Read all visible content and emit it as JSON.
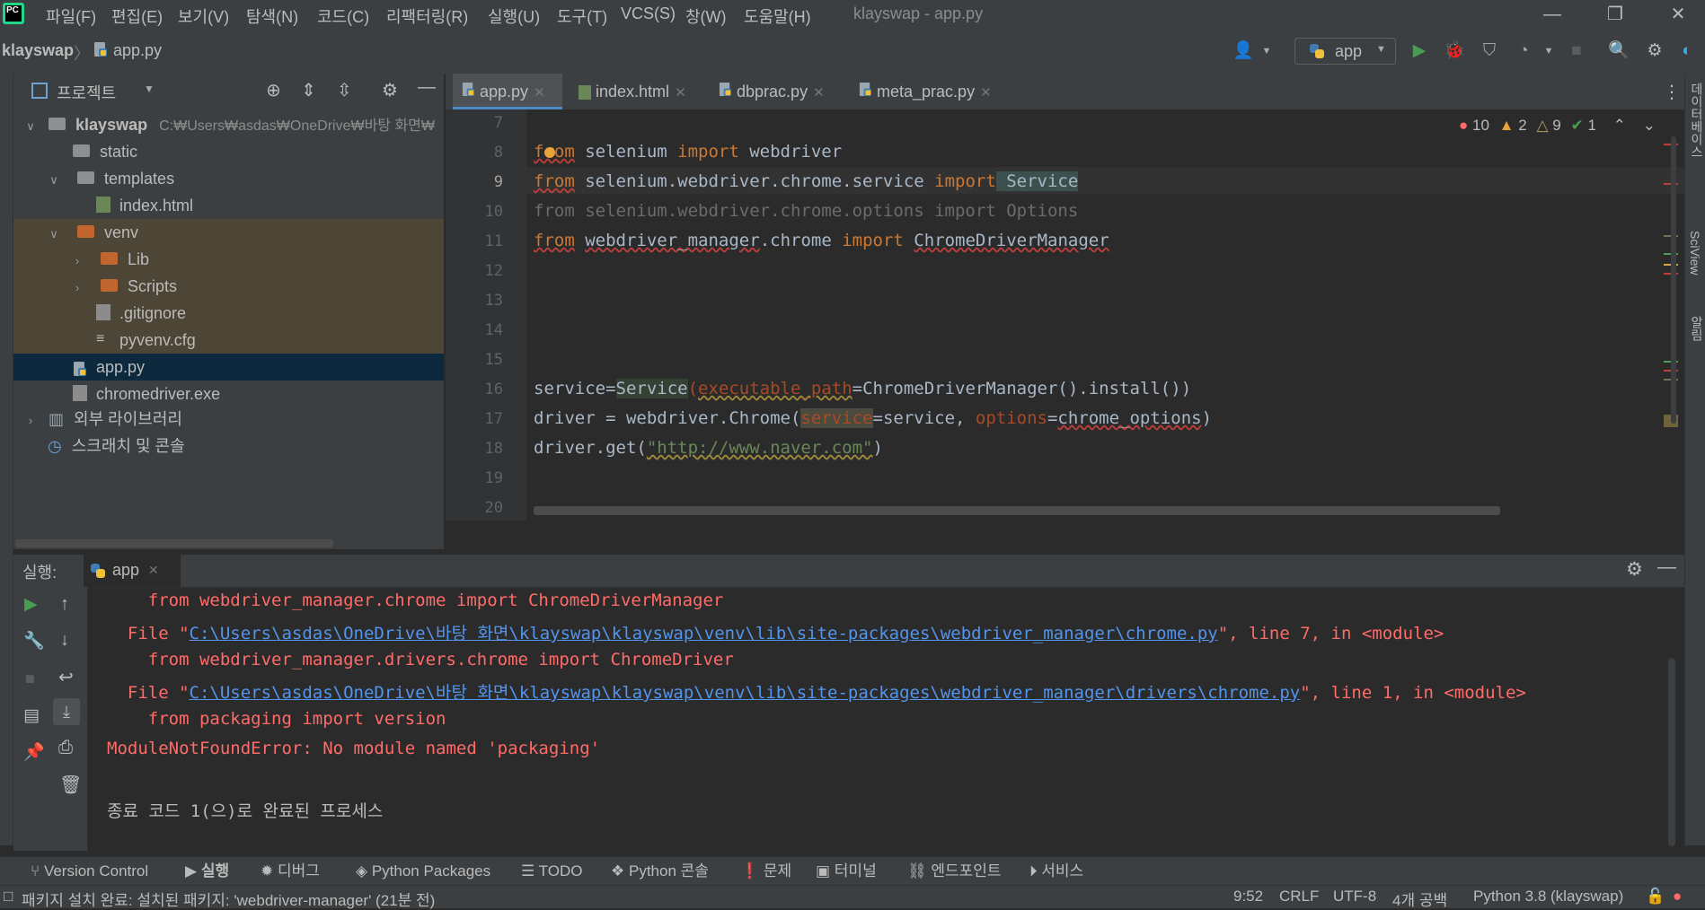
{
  "titlebar": {
    "menus": [
      "파일(F)",
      "편집(E)",
      "보기(V)",
      "탐색(N)",
      "코드(C)",
      "리팩터링(R)",
      "실행(U)",
      "도구(T)",
      "VCS(S)",
      "창(W)",
      "도움말(H)"
    ],
    "title": "klayswap - app.py",
    "logo_text": "PC"
  },
  "navbar": {
    "project": "klayswap",
    "file": "app.py",
    "run_config": "app"
  },
  "project_panel": {
    "header": "프로젝트",
    "root_name": "klayswap",
    "root_path": "C:₩Users₩asdas₩OneDrive₩바탕 화면₩",
    "items": [
      "static",
      "templates",
      "index.html",
      "venv",
      "Lib",
      "Scripts",
      ".gitignore",
      "pyvenv.cfg",
      "app.py",
      "chromedriver.exe",
      "외부 라이브러리",
      "스크래치 및 콘솔"
    ]
  },
  "editor": {
    "tabs": [
      "app.py",
      "index.html",
      "dbprac.py",
      "meta_prac.py"
    ],
    "inspections": {
      "errors": "10",
      "warnings": "2",
      "weak_warnings": "9",
      "ok": "1"
    },
    "line_numbers": [
      "7",
      "8",
      "9",
      "10",
      "11",
      "12",
      "13",
      "14",
      "15",
      "16",
      "17",
      "18",
      "19",
      "20"
    ],
    "code": {
      "l8": [
        "from",
        " selenium ",
        "import",
        " webdriver"
      ],
      "l9": [
        "from",
        " selenium.webdriver.chrome.service ",
        "import",
        " Service"
      ],
      "l10": "from selenium.webdriver.chrome.options import Options",
      "l11": [
        "from",
        " ",
        "webdriver_manager",
        ".chrome ",
        "import",
        " ",
        "ChromeDriverManager"
      ],
      "l16": [
        "service=",
        "Service",
        "(",
        "executable_path",
        "=ChromeDriverManager().install())"
      ],
      "l17": [
        "driver = webdriver.Chrome(",
        "service",
        "=service, ",
        "options",
        "=",
        "chrome_options",
        ")"
      ],
      "l18": [
        "driver.get(",
        "\"http://www.naver.com\"",
        ")"
      ]
    }
  },
  "run_panel": {
    "label": "실행:",
    "tab": "app",
    "output": [
      "    from webdriver_manager.chrome import ChromeDriverManager",
      "  File \"",
      "C:\\Users\\asdas\\OneDrive\\바탕 화면\\klayswap\\klayswap\\venv\\lib\\site-packages\\webdriver_manager\\chrome.py",
      "\", line 7, in <module>",
      "    from webdriver_manager.drivers.chrome import ChromeDriver",
      "  File \"",
      "C:\\Users\\asdas\\OneDrive\\바탕 화면\\klayswap\\klayswap\\venv\\lib\\site-packages\\webdriver_manager\\drivers\\chrome.py",
      "\", line 1, in <module>",
      "    from packaging import version",
      "ModuleNotFoundError: No module named 'packaging'",
      "종료 코드 1(으)로 완료된 프로세스"
    ]
  },
  "tool_tabs": [
    "Version Control",
    "실행",
    "디버그",
    "Python Packages",
    "TODO",
    "Python 콘솔",
    "문제",
    "터미널",
    "엔드포인트",
    "서비스"
  ],
  "statusbar": {
    "message": "패키지 설치 완료: 설치된 패키지: 'webdriver-manager' (21분 전)",
    "position": "9:52",
    "line_sep": "CRLF",
    "encoding": "UTF-8",
    "indent": "4개 공백",
    "interpreter": "Python 3.8 (klayswap)"
  },
  "right_strip": [
    "데이터베이스",
    "SciView",
    "알림"
  ],
  "colors": {
    "accent": "#4a88c7",
    "error": "#ff6b68",
    "keyword": "#cc7832",
    "string": "#6a8759"
  }
}
